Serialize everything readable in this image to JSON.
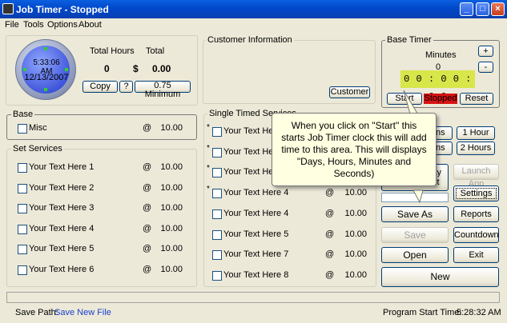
{
  "window": {
    "title": "Job Timer - Stopped"
  },
  "menu": [
    "File",
    "Tools",
    "Options",
    "About"
  ],
  "clock": {
    "time": "5:33:06 AM",
    "date": "12/13/2007"
  },
  "totals": {
    "hours_label": "Total Hours",
    "total_label": "Total",
    "hours_value": "0",
    "currency": "$",
    "total_value": "0.00",
    "copy_label": "Copy",
    "help_label": "?",
    "minimum_label": "0.75 Minimum"
  },
  "customer": {
    "group_label": "Customer Information",
    "button_label": "Customer"
  },
  "base_timer": {
    "group_label": "Base Timer",
    "minutes_label": "Minutes",
    "minutes_value": "0",
    "plus_label": "+",
    "minus_label": "-",
    "display": "0 0 : 0 0 : 0 0",
    "start_label": "Start",
    "status_label": "Stopped",
    "reset_label": "Reset"
  },
  "base": {
    "group_label": "Base",
    "items": [
      {
        "label": "Misc",
        "at": "@",
        "rate": "10.00"
      }
    ]
  },
  "set_services": {
    "group_label": "Set Services",
    "items": [
      {
        "label": "Your Text Here 1",
        "at": "@",
        "rate": "10.00"
      },
      {
        "label": "Your Text Here 2",
        "at": "@",
        "rate": "10.00"
      },
      {
        "label": "Your Text Here 3",
        "at": "@",
        "rate": "10.00"
      },
      {
        "label": "Your Text Here 4",
        "at": "@",
        "rate": "10.00"
      },
      {
        "label": "Your Text Here 5",
        "at": "@",
        "rate": "10.00"
      },
      {
        "label": "Your Text Here 6",
        "at": "@",
        "rate": "10.00"
      }
    ]
  },
  "single_timed": {
    "group_label": "Single Timed Services",
    "items": [
      {
        "label": "Your Text Here 1",
        "at": "@",
        "rate": "10.00"
      },
      {
        "label": "Your Text Here 2",
        "at": "@",
        "rate": "10.00"
      },
      {
        "label": "Your Text Here 3",
        "at": "@",
        "rate": "10.00"
      },
      {
        "label": "Your Text Here 4",
        "at": "@",
        "rate": "10.00"
      },
      {
        "label": "Your Text Here 4",
        "at": "@",
        "rate": "10.00"
      },
      {
        "label": "Your Text Here 5",
        "at": "@",
        "rate": "10.00"
      },
      {
        "label": "Your Text Here 7",
        "at": "@",
        "rate": "10.00"
      },
      {
        "label": "Your Text Here 8",
        "at": "@",
        "rate": "10.00"
      }
    ]
  },
  "quick_add": {
    "mins_a": "mins",
    "mins_b": "mins",
    "one_hour": "1 Hour",
    "two_hours": "2 Hours",
    "play_label": "lay",
    "wait_label": "ait"
  },
  "actions": {
    "launch_app": "Launch App",
    "settings": "Settings",
    "save_as": "Save As",
    "reports": "Reports",
    "save": "Save",
    "countdown": "Countdown",
    "open": "Open",
    "exit": "Exit",
    "new": "New"
  },
  "callout": {
    "text": "When you click on \"Start\" this starts Job Timer clock this will add time to this area. This will displays \"Days, Hours, Minutes and Seconds)"
  },
  "footer": {
    "save_path_label": "Save Path:",
    "save_path_value": "Save New File",
    "program_start_label": "Program Start Time:",
    "program_start_value": "5:28:32 AM"
  },
  "colors": {
    "title_bar": "#0046c8",
    "lcd": "#d8e64a",
    "stopped": "#d81313",
    "link_blue": "#1a3fd0",
    "callout_bg": "#ffffe1"
  }
}
